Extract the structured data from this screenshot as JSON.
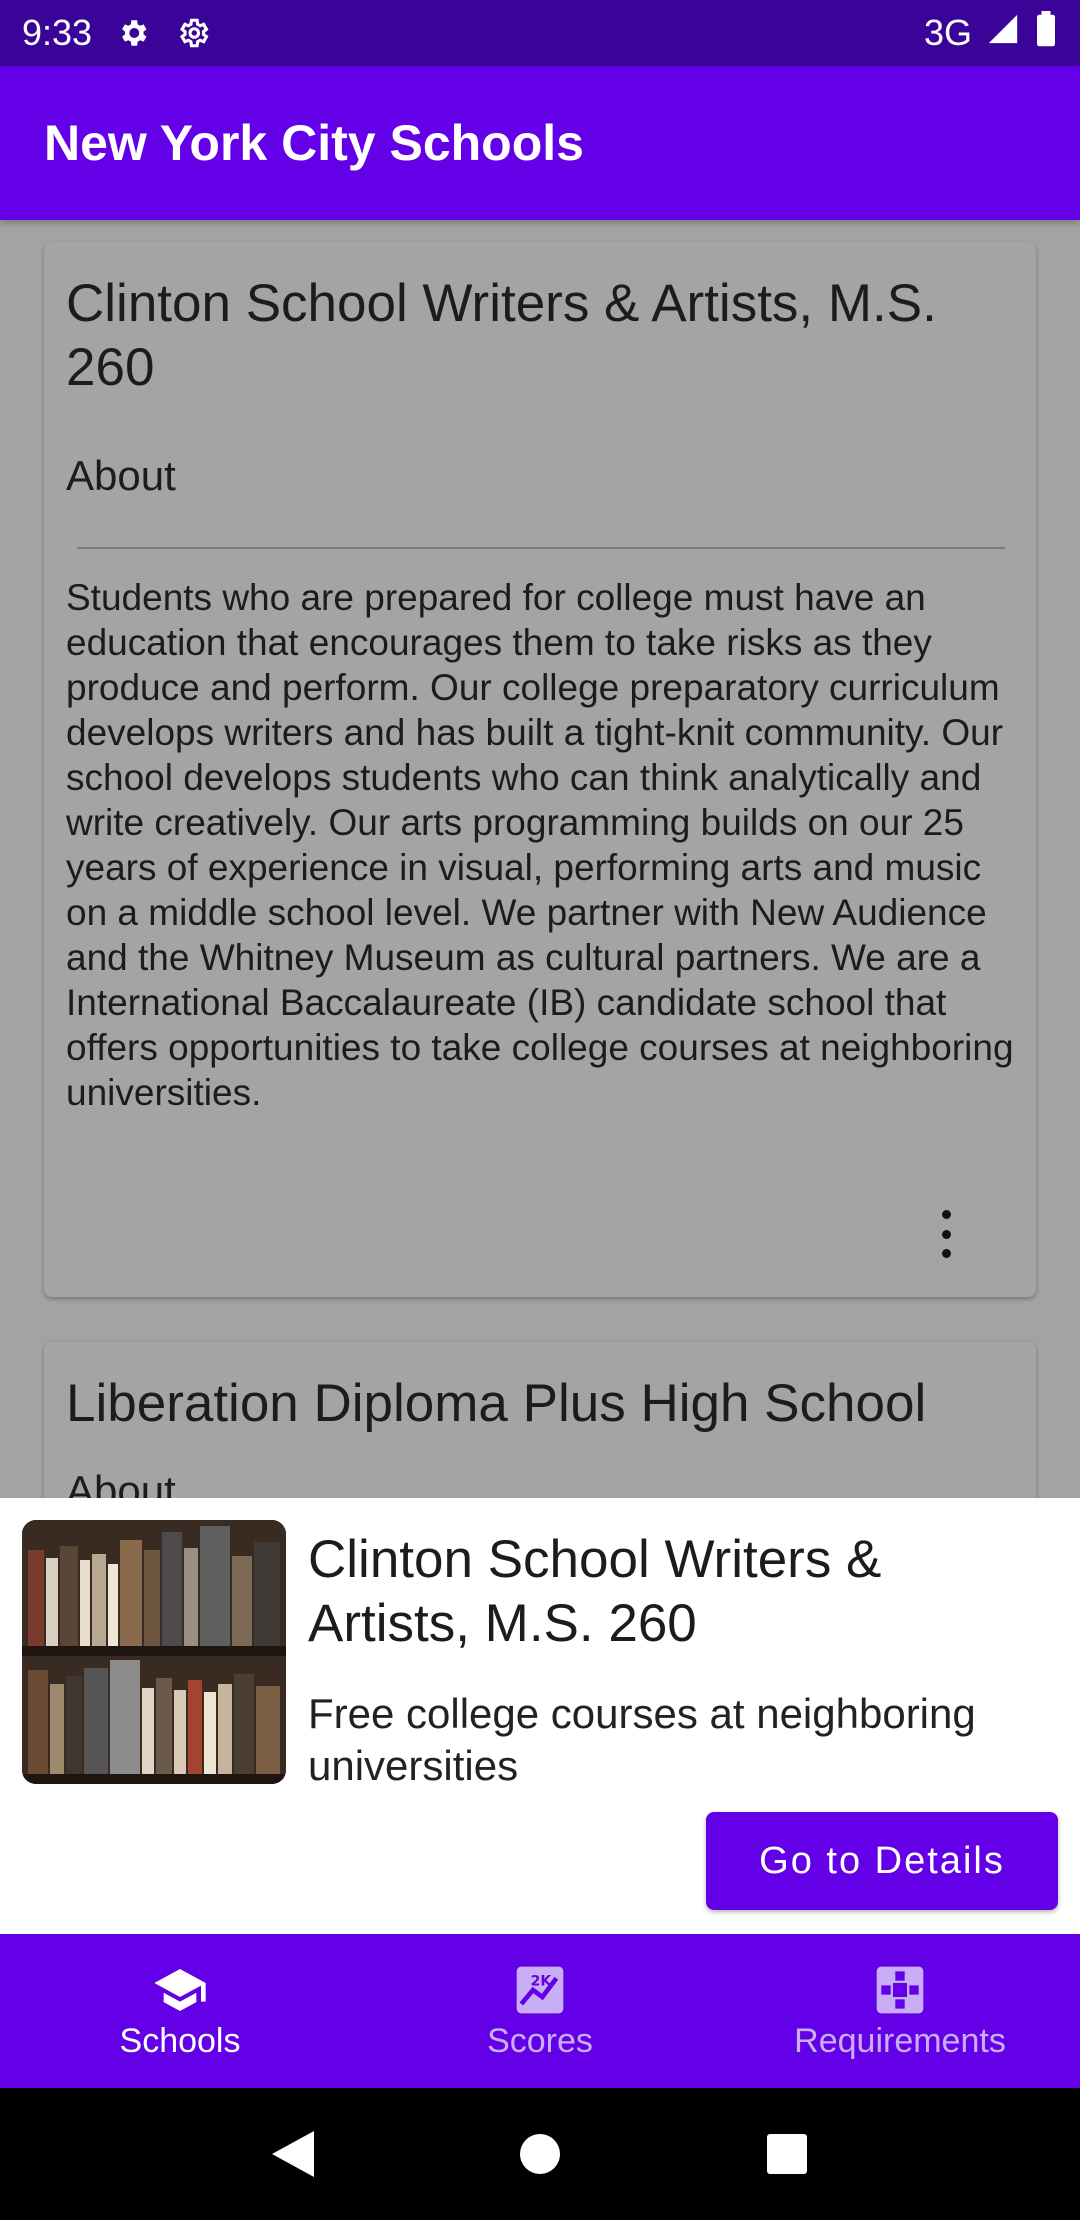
{
  "status_bar": {
    "time": "9:33",
    "network": "3G",
    "icons": [
      "gear-icon",
      "settings-icon",
      "signal-icon",
      "battery-icon"
    ]
  },
  "app_bar": {
    "title": "New York City Schools"
  },
  "schools": [
    {
      "name": "Clinton School Writers & Artists, M.S. 260",
      "about_label": "About",
      "description": "Students who are prepared for college must have an education that encourages them to take risks as they produce and perform. Our college preparatory curriculum develops writers and has built a tight-knit community. Our school develops students who can think analytically and write creatively. Our arts programming builds on our 25 years of experience in visual, performing arts and music on a middle school level. We partner with New Audience and the Whitney Museum as cultural partners. We are a International Baccalaureate (IB) candidate school that offers opportunities to take college courses at neighboring universities."
    },
    {
      "name": "Liberation Diploma Plus High School",
      "about_label": "About"
    }
  ],
  "sheet": {
    "title": "Clinton School Writers & Artists, M.S. 260",
    "subtitle": "Free college courses at neighboring universities",
    "button_label": "Go to Details"
  },
  "bottom_nav": {
    "items": [
      {
        "label": "Schools",
        "icon": "school-cap-icon",
        "active": true
      },
      {
        "label": "Scores",
        "icon": "scores-chart-icon",
        "active": false
      },
      {
        "label": "Requirements",
        "icon": "requirements-icon",
        "active": false
      }
    ]
  },
  "colors": {
    "primary": "#6300e8",
    "status_bar": "#3a0499",
    "inactive_nav": "#c9aef5"
  }
}
